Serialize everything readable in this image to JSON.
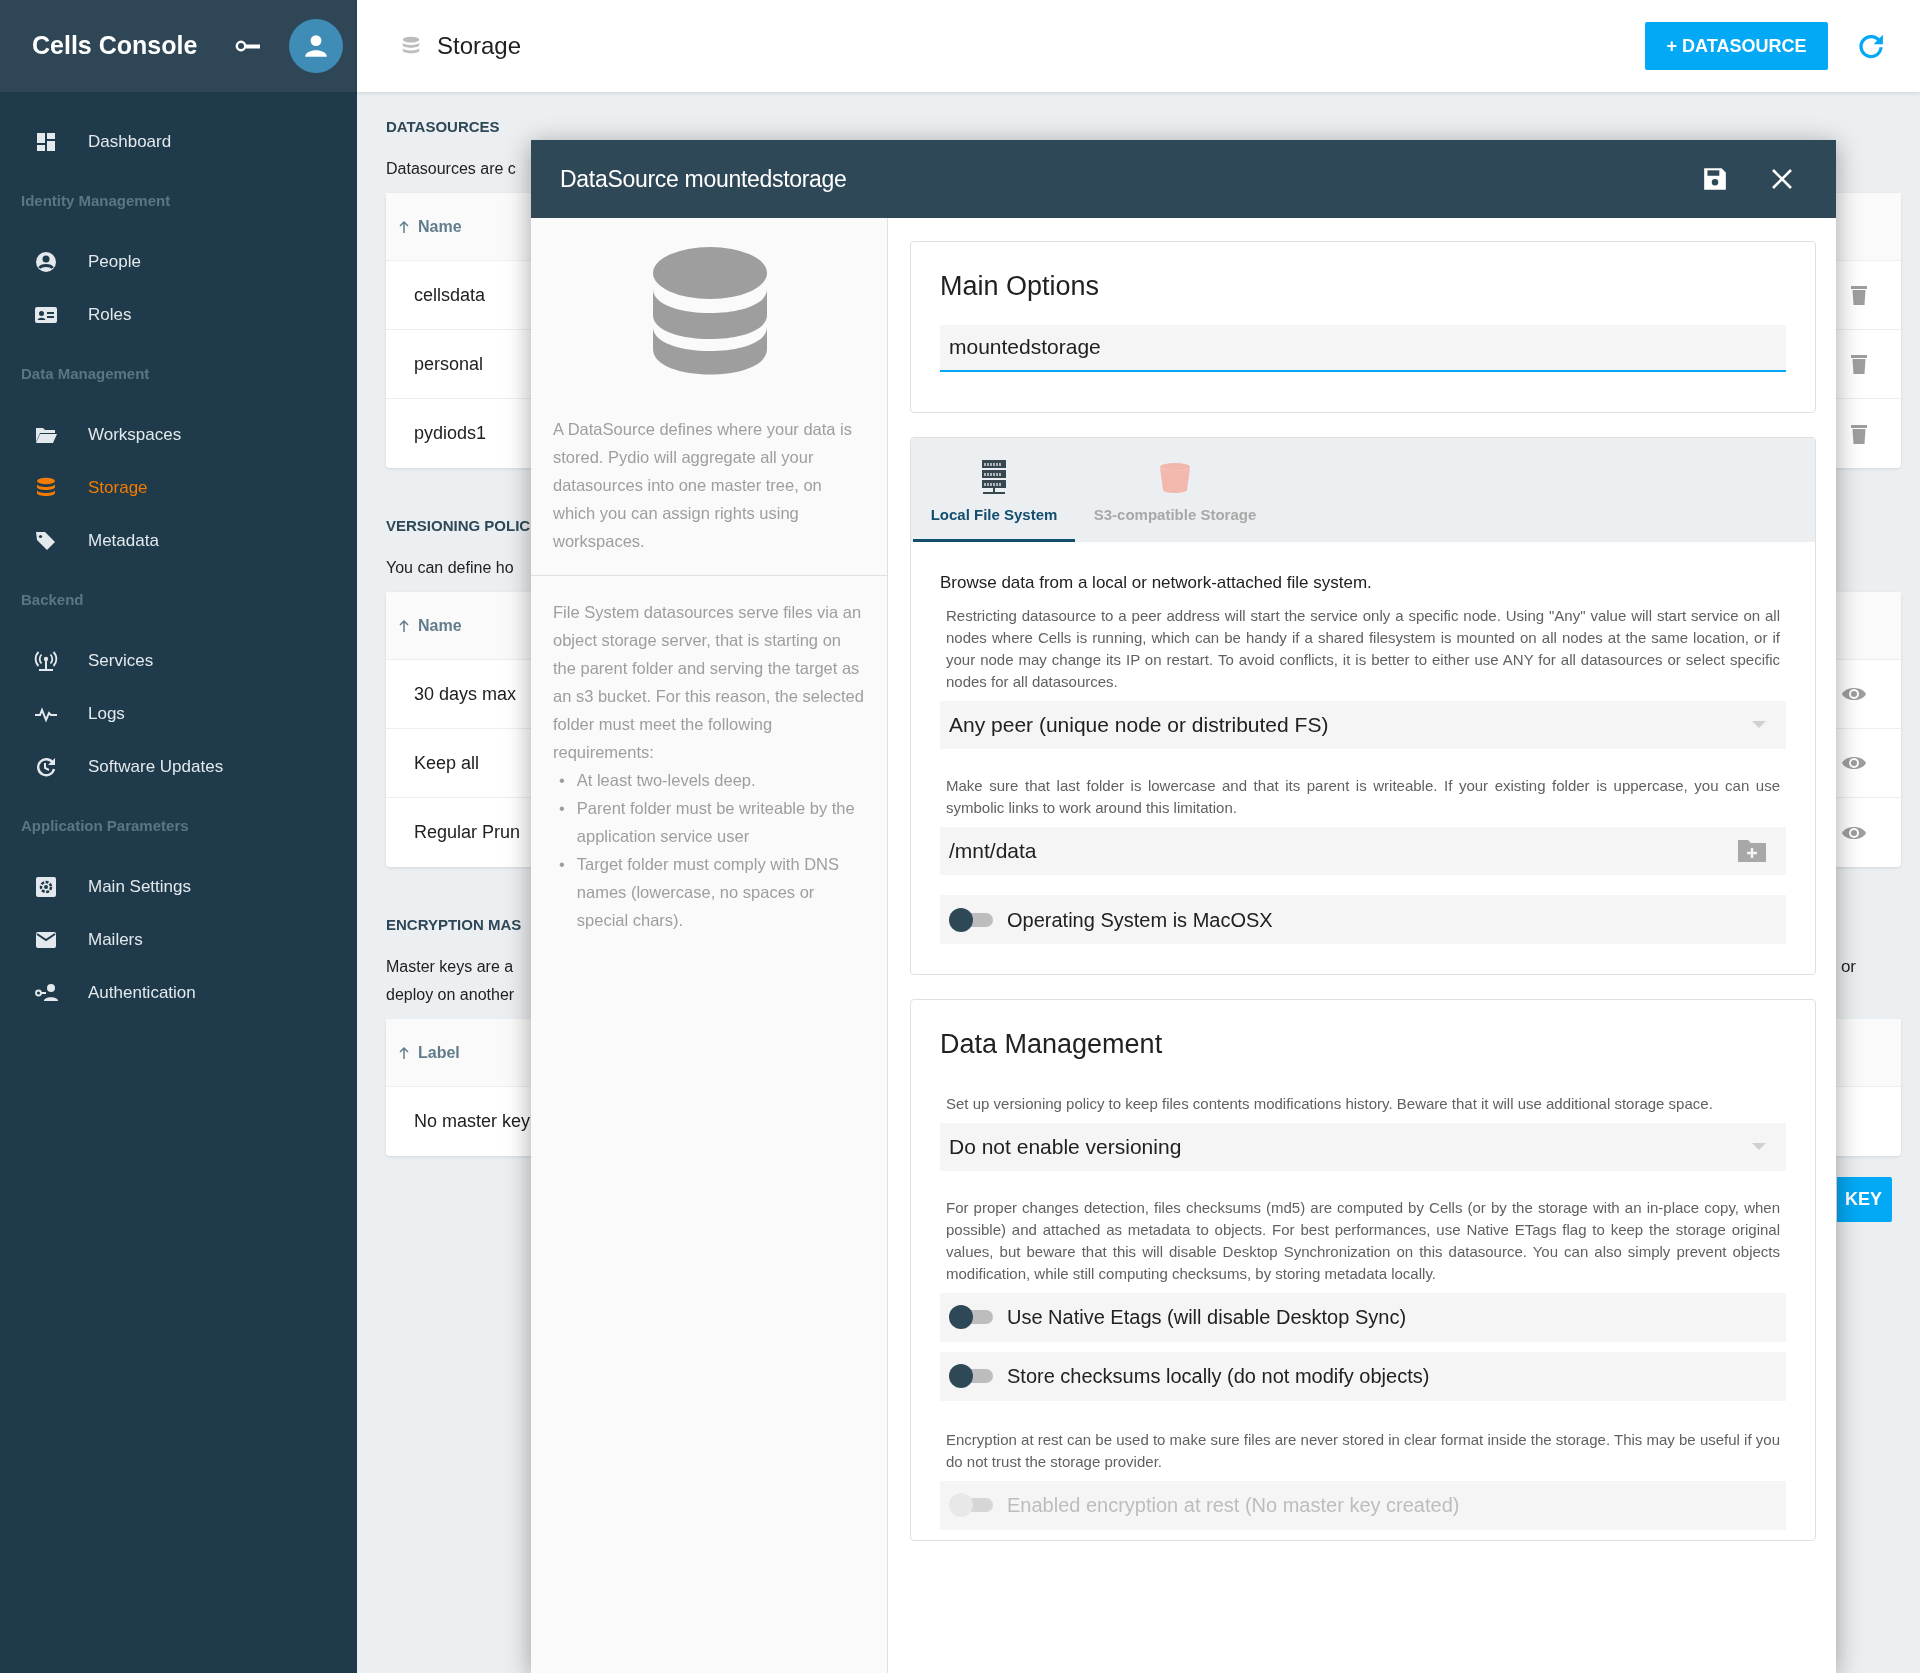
{
  "sidebar": {
    "title": "Cells Console",
    "items": [
      {
        "kind": "link",
        "label": "Dashboard",
        "selected": false
      },
      {
        "kind": "heading",
        "label": "Identity Management"
      },
      {
        "kind": "link",
        "label": "People",
        "selected": false
      },
      {
        "kind": "link",
        "label": "Roles",
        "selected": false
      },
      {
        "kind": "heading",
        "label": "Data Management"
      },
      {
        "kind": "link",
        "label": "Workspaces",
        "selected": false
      },
      {
        "kind": "link",
        "label": "Storage",
        "selected": true
      },
      {
        "kind": "link",
        "label": "Metadata",
        "selected": false
      },
      {
        "kind": "heading",
        "label": "Backend"
      },
      {
        "kind": "link",
        "label": "Services",
        "selected": false
      },
      {
        "kind": "link",
        "label": "Logs",
        "selected": false
      },
      {
        "kind": "link",
        "label": "Software Updates",
        "selected": false
      },
      {
        "kind": "heading",
        "label": "Application Parameters"
      },
      {
        "kind": "link",
        "label": "Main Settings",
        "selected": false
      },
      {
        "kind": "link",
        "label": "Mailers",
        "selected": false
      },
      {
        "kind": "link",
        "label": "Authentication",
        "selected": false
      }
    ]
  },
  "header": {
    "title": "Storage",
    "add_button": "+ DATASOURCE"
  },
  "page": {
    "sections": [
      {
        "title": "DATASOURCES",
        "description": [
          "Datasources are c"
        ],
        "table": {
          "column": "Name",
          "rows": [
            "cellsdata",
            "personal",
            "pydiods1"
          ]
        }
      },
      {
        "title": "VERSIONING POLIC",
        "description": [
          "You can define ho"
        ],
        "table": {
          "column": "Name",
          "rows": [
            "30 days max",
            "Keep all",
            "Regular Prun"
          ]
        }
      },
      {
        "title": "ENCRYPTION MAS",
        "description": [
          "Master keys are a",
          "deploy on another"
        ],
        "description_tail": "or",
        "table": {
          "column": "Label",
          "rows": [
            "No master key"
          ]
        },
        "button": "KEY"
      }
    ]
  },
  "modal": {
    "title": "DataSource mountedstorage",
    "intro": "A DataSource defines where your data is stored. Pydio will aggregate all your datasources into one master tree, on which you can assign rights using workspaces.",
    "requirements_intro": "File System datasources serve files via an object storage server, that is starting on the parent folder and serving the target as an s3 bucket. For this reason, the selected folder must meet the following requirements:",
    "requirements_marker": "•",
    "requirements": [
      "At least two-levels deep.",
      "Parent folder must be writeable by the application service user",
      "Target folder must comply with DNS names (lowercase, no spaces or special chars)."
    ],
    "main_options": {
      "title": "Main Options",
      "name_value": "mountedstorage"
    },
    "storage_tabs": [
      {
        "label": "Local File System",
        "selected": true
      },
      {
        "label": "S3-compatible Storage",
        "selected": false
      }
    ],
    "storage": {
      "heading": "Browse data from a local or network-attached file system.",
      "peer_help": "Restricting datasource to a peer address will start the service only a specific node. Using \"Any\" value will start service on all nodes where Cells is running, which can be handy if a shared filesystem is mounted on all nodes at the same location, or if your node may change its IP on restart. To avoid conflicts, it is better to either use ANY for all datasources or select specific nodes for all datasources.",
      "peer_value": "Any peer (unique node or distributed FS)",
      "folder_help": "Make sure that last folder is lowercase and that its parent is writeable. If your existing folder is uppercase, you can use symbolic links to work around this limitation.",
      "folder_value": "/mnt/data",
      "toggles": [
        {
          "label": "Operating System is MacOSX",
          "on": false,
          "disabled": false
        }
      ]
    },
    "data_management": {
      "title": "Data Management",
      "versioning_help": "Set up versioning policy to keep files contents modifications history. Beware that it will use additional storage space.",
      "versioning_value": "Do not enable versioning",
      "checksum_help": "For proper changes detection, files checksums (md5) are computed by Cells (or by the storage with an in-place copy, when possible) and attached as metadata to objects. For best performances, use Native ETags flag to keep the storage original values, but beware that this will disable Desktop Synchronization on this datasource. You can also simply prevent objects modification, while still computing checksums, by storing metadata locally.",
      "toggles": [
        {
          "label": "Use Native Etags (will disable Desktop Sync)",
          "on": false,
          "disabled": false
        },
        {
          "label": "Store checksums locally (do not modify objects)",
          "on": false,
          "disabled": false
        }
      ],
      "encryption_help": "Encryption at rest can be used to make sure files are never stored in clear format inside the storage. This may be useful if you do not trust the storage provider.",
      "encryption_toggles": [
        {
          "label": "Enabled encryption at rest (No master key created)",
          "on": false,
          "disabled": true
        }
      ]
    }
  }
}
